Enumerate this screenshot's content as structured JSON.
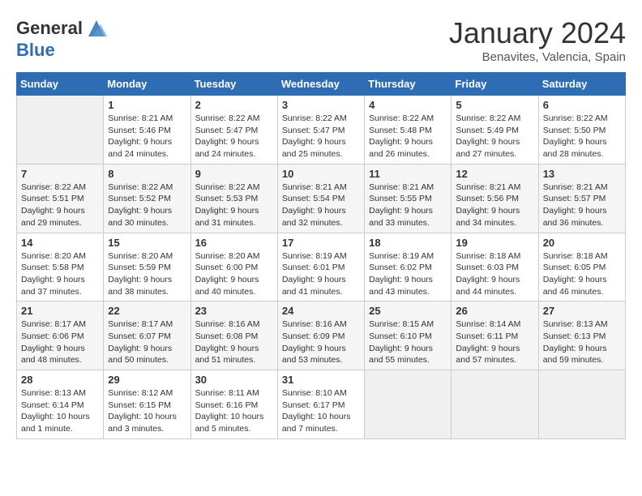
{
  "header": {
    "logo_line1": "General",
    "logo_line2": "Blue",
    "month_title": "January 2024",
    "subtitle": "Benavites, Valencia, Spain"
  },
  "days_of_week": [
    "Sunday",
    "Monday",
    "Tuesday",
    "Wednesday",
    "Thursday",
    "Friday",
    "Saturday"
  ],
  "weeks": [
    [
      {
        "day": "",
        "empty": true
      },
      {
        "day": "1",
        "sunrise": "Sunrise: 8:21 AM",
        "sunset": "Sunset: 5:46 PM",
        "daylight": "Daylight: 9 hours and 24 minutes."
      },
      {
        "day": "2",
        "sunrise": "Sunrise: 8:22 AM",
        "sunset": "Sunset: 5:47 PM",
        "daylight": "Daylight: 9 hours and 24 minutes."
      },
      {
        "day": "3",
        "sunrise": "Sunrise: 8:22 AM",
        "sunset": "Sunset: 5:47 PM",
        "daylight": "Daylight: 9 hours and 25 minutes."
      },
      {
        "day": "4",
        "sunrise": "Sunrise: 8:22 AM",
        "sunset": "Sunset: 5:48 PM",
        "daylight": "Daylight: 9 hours and 26 minutes."
      },
      {
        "day": "5",
        "sunrise": "Sunrise: 8:22 AM",
        "sunset": "Sunset: 5:49 PM",
        "daylight": "Daylight: 9 hours and 27 minutes."
      },
      {
        "day": "6",
        "sunrise": "Sunrise: 8:22 AM",
        "sunset": "Sunset: 5:50 PM",
        "daylight": "Daylight: 9 hours and 28 minutes."
      }
    ],
    [
      {
        "day": "7",
        "sunrise": "Sunrise: 8:22 AM",
        "sunset": "Sunset: 5:51 PM",
        "daylight": "Daylight: 9 hours and 29 minutes."
      },
      {
        "day": "8",
        "sunrise": "Sunrise: 8:22 AM",
        "sunset": "Sunset: 5:52 PM",
        "daylight": "Daylight: 9 hours and 30 minutes."
      },
      {
        "day": "9",
        "sunrise": "Sunrise: 8:22 AM",
        "sunset": "Sunset: 5:53 PM",
        "daylight": "Daylight: 9 hours and 31 minutes."
      },
      {
        "day": "10",
        "sunrise": "Sunrise: 8:21 AM",
        "sunset": "Sunset: 5:54 PM",
        "daylight": "Daylight: 9 hours and 32 minutes."
      },
      {
        "day": "11",
        "sunrise": "Sunrise: 8:21 AM",
        "sunset": "Sunset: 5:55 PM",
        "daylight": "Daylight: 9 hours and 33 minutes."
      },
      {
        "day": "12",
        "sunrise": "Sunrise: 8:21 AM",
        "sunset": "Sunset: 5:56 PM",
        "daylight": "Daylight: 9 hours and 34 minutes."
      },
      {
        "day": "13",
        "sunrise": "Sunrise: 8:21 AM",
        "sunset": "Sunset: 5:57 PM",
        "daylight": "Daylight: 9 hours and 36 minutes."
      }
    ],
    [
      {
        "day": "14",
        "sunrise": "Sunrise: 8:20 AM",
        "sunset": "Sunset: 5:58 PM",
        "daylight": "Daylight: 9 hours and 37 minutes."
      },
      {
        "day": "15",
        "sunrise": "Sunrise: 8:20 AM",
        "sunset": "Sunset: 5:59 PM",
        "daylight": "Daylight: 9 hours and 38 minutes."
      },
      {
        "day": "16",
        "sunrise": "Sunrise: 8:20 AM",
        "sunset": "Sunset: 6:00 PM",
        "daylight": "Daylight: 9 hours and 40 minutes."
      },
      {
        "day": "17",
        "sunrise": "Sunrise: 8:19 AM",
        "sunset": "Sunset: 6:01 PM",
        "daylight": "Daylight: 9 hours and 41 minutes."
      },
      {
        "day": "18",
        "sunrise": "Sunrise: 8:19 AM",
        "sunset": "Sunset: 6:02 PM",
        "daylight": "Daylight: 9 hours and 43 minutes."
      },
      {
        "day": "19",
        "sunrise": "Sunrise: 8:18 AM",
        "sunset": "Sunset: 6:03 PM",
        "daylight": "Daylight: 9 hours and 44 minutes."
      },
      {
        "day": "20",
        "sunrise": "Sunrise: 8:18 AM",
        "sunset": "Sunset: 6:05 PM",
        "daylight": "Daylight: 9 hours and 46 minutes."
      }
    ],
    [
      {
        "day": "21",
        "sunrise": "Sunrise: 8:17 AM",
        "sunset": "Sunset: 6:06 PM",
        "daylight": "Daylight: 9 hours and 48 minutes."
      },
      {
        "day": "22",
        "sunrise": "Sunrise: 8:17 AM",
        "sunset": "Sunset: 6:07 PM",
        "daylight": "Daylight: 9 hours and 50 minutes."
      },
      {
        "day": "23",
        "sunrise": "Sunrise: 8:16 AM",
        "sunset": "Sunset: 6:08 PM",
        "daylight": "Daylight: 9 hours and 51 minutes."
      },
      {
        "day": "24",
        "sunrise": "Sunrise: 8:16 AM",
        "sunset": "Sunset: 6:09 PM",
        "daylight": "Daylight: 9 hours and 53 minutes."
      },
      {
        "day": "25",
        "sunrise": "Sunrise: 8:15 AM",
        "sunset": "Sunset: 6:10 PM",
        "daylight": "Daylight: 9 hours and 55 minutes."
      },
      {
        "day": "26",
        "sunrise": "Sunrise: 8:14 AM",
        "sunset": "Sunset: 6:11 PM",
        "daylight": "Daylight: 9 hours and 57 minutes."
      },
      {
        "day": "27",
        "sunrise": "Sunrise: 8:13 AM",
        "sunset": "Sunset: 6:13 PM",
        "daylight": "Daylight: 9 hours and 59 minutes."
      }
    ],
    [
      {
        "day": "28",
        "sunrise": "Sunrise: 8:13 AM",
        "sunset": "Sunset: 6:14 PM",
        "daylight": "Daylight: 10 hours and 1 minute."
      },
      {
        "day": "29",
        "sunrise": "Sunrise: 8:12 AM",
        "sunset": "Sunset: 6:15 PM",
        "daylight": "Daylight: 10 hours and 3 minutes."
      },
      {
        "day": "30",
        "sunrise": "Sunrise: 8:11 AM",
        "sunset": "Sunset: 6:16 PM",
        "daylight": "Daylight: 10 hours and 5 minutes."
      },
      {
        "day": "31",
        "sunrise": "Sunrise: 8:10 AM",
        "sunset": "Sunset: 6:17 PM",
        "daylight": "Daylight: 10 hours and 7 minutes."
      },
      {
        "day": "",
        "empty": true
      },
      {
        "day": "",
        "empty": true
      },
      {
        "day": "",
        "empty": true
      }
    ]
  ]
}
